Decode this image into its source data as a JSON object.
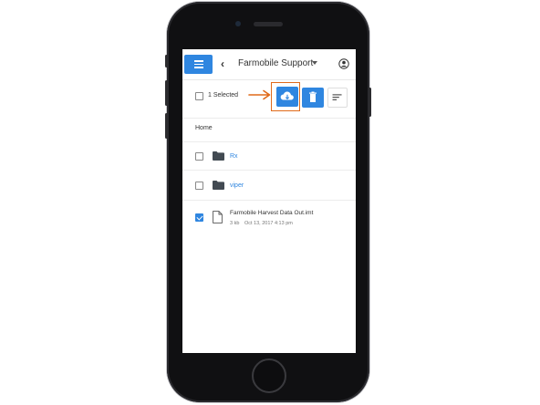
{
  "header": {
    "title": "Farmobile Support"
  },
  "toolbar": {
    "selected_label": "1 Selected"
  },
  "breadcrumb": "Home",
  "files": {
    "folders": [
      {
        "name": "Rx"
      },
      {
        "name": "viper"
      }
    ],
    "file": {
      "name": "Farmobile Harvest Data Out.imt",
      "size": "3 kb",
      "date": "Oct 13, 2017 4:13 pm"
    }
  },
  "colors": {
    "accent": "#2f86e0",
    "highlight": "#e06a1a",
    "folder": "#424a52"
  },
  "icons": [
    "menu-icon",
    "chevron-left-icon",
    "caret-down-icon",
    "user-icon",
    "cloud-download-icon",
    "trash-icon",
    "sort-icon",
    "folder-icon",
    "file-icon",
    "arrow-right-icon"
  ]
}
